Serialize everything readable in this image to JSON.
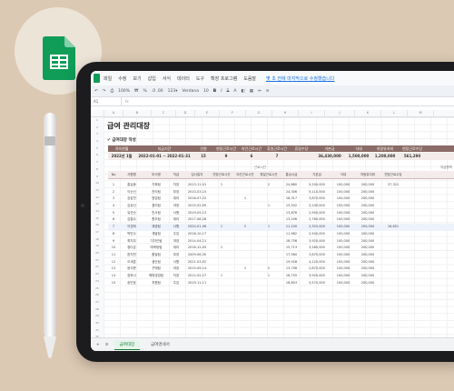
{
  "menubar": {
    "items": [
      "파일",
      "수정",
      "보기",
      "삽입",
      "서식",
      "데이터",
      "도구",
      "확장 프로그램",
      "도움말"
    ],
    "last_edit": "몇 초 전에 마지막으로 수정했습니다"
  },
  "toolbar": {
    "zoom": "100%",
    "currency": "₩",
    "percent": "%",
    "decimals": ".0  .00",
    "format": "123▾",
    "font": "Verdana",
    "font_size": "10",
    "bold": "B",
    "italic": "I",
    "strike": "S",
    "textcolor": "A"
  },
  "formula": {
    "cell": "A1",
    "fx": "fx"
  },
  "sheet": {
    "title": "급여 관리대장",
    "subtitle": "✔ 급여대장 작성"
  },
  "summary": {
    "headers": [
      "귀속연월",
      "지급기간",
      "인원",
      "연장근로시간",
      "야간근로시간",
      "휴일근로시간",
      "휴일수당",
      "기본급",
      "식대",
      "차량유지비",
      "연장근로수당"
    ],
    "values": [
      "2022년 1월",
      "2022-01-01 ~ 2022-01-31",
      "15",
      "9",
      "6",
      "7",
      "",
      "36,430,000",
      "1,500,000",
      "1,200,000",
      "561,290"
    ]
  },
  "groups": {
    "work": "근로시간",
    "pay": "지급항목"
  },
  "table": {
    "headers": [
      "No",
      "사원명",
      "부서명",
      "직급",
      "입사일자",
      "연장근로시간",
      "야간근로시간",
      "휴일근로시간",
      "통상시급",
      "기본급",
      "식대",
      "차량유지비",
      "연장근로수당"
    ],
    "rows": [
      [
        "1",
        "홍길동",
        "기획팀",
        "차장",
        "2013-11-01",
        "1",
        "",
        "2",
        "24,880",
        "5,200,000",
        "100,000",
        "200,000",
        "37,321"
      ],
      [
        "2",
        "이순신",
        "관리팀",
        "부장",
        "2010-03-15",
        "",
        "",
        "",
        "24,306",
        "5,110,000",
        "100,000",
        "200,000",
        ""
      ],
      [
        "3",
        "강감찬",
        "영업팀",
        "대리",
        "2016-07-22",
        "",
        "1",
        "",
        "18,317",
        "3,870,000",
        "100,000",
        "200,000",
        ""
      ],
      [
        "4",
        "김유신",
        "경리팀",
        "과장",
        "2015-02-09",
        "",
        "",
        "1",
        "15,502",
        "3,240,000",
        "100,000",
        "200,000",
        ""
      ],
      [
        "5",
        "유관순",
        "인사팀",
        "사원",
        "2019-05-13",
        "",
        "",
        "",
        "13,876",
        "2,900,000",
        "100,000",
        "200,000",
        ""
      ],
      [
        "6",
        "김철수",
        "총무팀",
        "대리",
        "2017-08-28",
        "",
        "",
        "",
        "13,206",
        "2,760,000",
        "100,000",
        "200,000",
        ""
      ],
      [
        "7",
        "이영희",
        "재경팀",
        "사원",
        "2020-01-06",
        "1",
        "2",
        "1",
        "11,100",
        "2,320,000",
        "100,000",
        "200,000",
        "16,651"
      ],
      [
        "8",
        "박민수",
        "개발팀",
        "주임",
        "2018-10-17",
        "",
        "",
        "",
        "11,962",
        "2,500,000",
        "100,000",
        "200,000",
        ""
      ],
      [
        "9",
        "최지우",
        "디자인팀",
        "과장",
        "2014-04-21",
        "",
        "",
        "",
        "18,756",
        "3,920,000",
        "100,000",
        "200,000",
        ""
      ],
      [
        "10",
        "정다은",
        "마케팅팀",
        "대리",
        "2016-12-05",
        "1",
        "",
        "",
        "15,713",
        "3,280,000",
        "100,000",
        "200,000",
        ""
      ],
      [
        "11",
        "한지민",
        "품질팀",
        "부장",
        "2009-06-30",
        "",
        "",
        "",
        "17,560",
        "3,670,000",
        "100,000",
        "200,000",
        ""
      ],
      [
        "12",
        "오세훈",
        "생산팀",
        "사원",
        "2021-03-02",
        "",
        "",
        "",
        "19,928",
        "4,120,000",
        "100,000",
        "200,000",
        ""
      ],
      [
        "13",
        "윤서준",
        "구매팀",
        "과장",
        "2015-09-14",
        "",
        "1",
        "2",
        "13,756",
        "2,870,000",
        "100,000",
        "200,000",
        ""
      ],
      [
        "14",
        "장하나",
        "해외영업팀",
        "차장",
        "2012-02-27",
        "1",
        "",
        "1",
        "18,755",
        "3,920,000",
        "100,000",
        "200,000",
        ""
      ],
      [
        "15",
        "송민호",
        "지원팀",
        "주임",
        "2019-11-11",
        "",
        "",
        "",
        "16,803",
        "3,570,000",
        "100,000",
        "200,000",
        ""
      ]
    ],
    "empty_rows": 11
  },
  "tabs": [
    "급여대장",
    "급여명세서"
  ],
  "colors": {
    "brand_green": "#0f9d58",
    "header_brown": "#8a6b65",
    "band_pink": "#f3ecea"
  },
  "icons": {
    "app": "google-sheets-icon",
    "pencil": "stylus-pencil",
    "add": "add-sheet-icon",
    "list": "sheet-list-icon"
  }
}
